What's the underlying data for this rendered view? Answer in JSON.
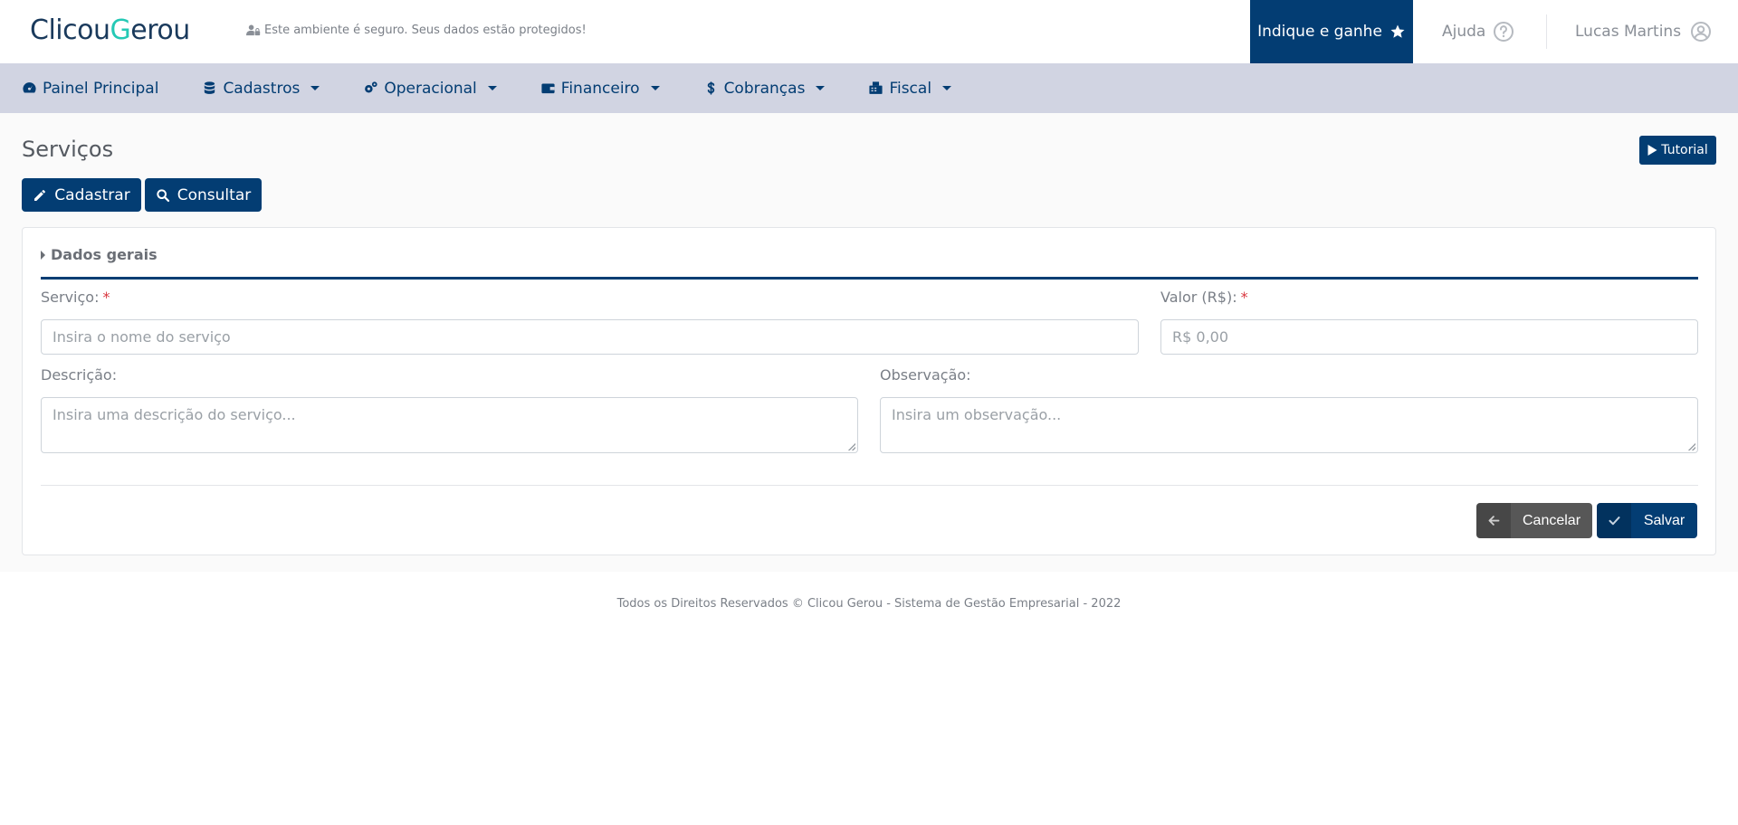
{
  "header": {
    "logo_part1": "Clicou",
    "logo_part2": "G",
    "logo_part3": "erou",
    "secure_text": "Este ambiente é seguro. Seus dados estão protegidos!",
    "indique_label": "Indique e ganhe",
    "ajuda_label": "Ajuda",
    "user_name": "Lucas Martins"
  },
  "nav": {
    "items": [
      {
        "label": "Painel Principal",
        "icon": "dashboard-icon"
      },
      {
        "label": "Cadastros",
        "icon": "database-icon"
      },
      {
        "label": "Operacional",
        "icon": "gears-icon"
      },
      {
        "label": "Financeiro",
        "icon": "wallet-icon"
      },
      {
        "label": "Cobranças",
        "icon": "dollar-icon"
      },
      {
        "label": "Fiscal",
        "icon": "fiscal-icon"
      }
    ]
  },
  "page": {
    "title": "Serviços",
    "tutorial_label": "Tutorial",
    "cadastrar_label": "Cadastrar",
    "consultar_label": "Consultar"
  },
  "form": {
    "section_title": "Dados gerais",
    "servico_label": "Serviço:",
    "servico_placeholder": "Insira o nome do serviço",
    "valor_label": "Valor (R$):",
    "valor_placeholder": "R$ 0,00",
    "descricao_label": "Descrição:",
    "descricao_placeholder": "Insira uma descrição do serviço...",
    "observacao_label": "Observação:",
    "observacao_placeholder": "Insira um observação...",
    "required_mark": "*",
    "cancel_label": "Cancelar",
    "save_label": "Salvar"
  },
  "footer": {
    "text": "Todos os Direitos Reservados © Clicou Gerou - Sistema de Gestão Empresarial - 2022"
  },
  "colors": {
    "primary": "#033d73",
    "nav_bg": "#d1d4e2",
    "accent": "#25c9b5",
    "required": "#d9363e"
  }
}
